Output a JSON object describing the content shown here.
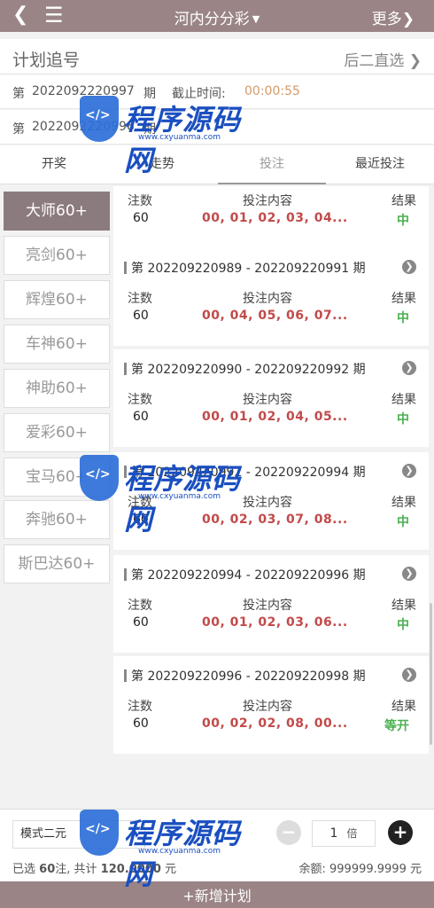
{
  "header": {
    "back_icon": "back-arrow-icon",
    "menu_icon": "hamburger-menu-icon",
    "title": "河内分分彩",
    "more_label": "更多"
  },
  "subhead": {
    "left_label": "计划追号",
    "right_label": "后二直选"
  },
  "issue_rows": [
    {
      "prefix": "第",
      "number": "2022092220997",
      "suffix": "期",
      "deadline_label": "截止时间:",
      "deadline_value": "00:00:55"
    },
    {
      "prefix": "第",
      "number": "2022092220996",
      "suffix": "期"
    }
  ],
  "tabs": [
    "开奖",
    "走势",
    "投注",
    "最近投注"
  ],
  "sidebar": [
    "大师60+",
    "亮剑60+",
    "辉煌60+",
    "车神60+",
    "神助60+",
    "爱彩60+",
    "宝马60+",
    "奔驰60+",
    "斯巴达60+"
  ],
  "card_labels": {
    "count": "注数",
    "content": "投注内容",
    "result": "结果"
  },
  "cards": [
    {
      "period": "",
      "count": "60",
      "numbers": "00, 01, 02, 03, 04...",
      "result": "中"
    },
    {
      "period": "第 202209220989 - 202209220991 期",
      "count": "60",
      "numbers": "00, 04, 05, 06, 07...",
      "result": "中"
    },
    {
      "period": "第 202209220990 - 202209220992 期",
      "count": "60",
      "numbers": "00, 01, 02, 04, 05...",
      "result": "中"
    },
    {
      "period": "第 202209220992 - 202209220994 期",
      "count": "60",
      "numbers": "00, 02, 03, 07, 08...",
      "result": "中"
    },
    {
      "period": "第 202209220994 - 202209220996 期",
      "count": "60",
      "numbers": "00, 01, 02, 03, 06...",
      "result": "中"
    },
    {
      "period": "第 202209220996 - 202209220998 期",
      "count": "60",
      "numbers": "00, 02, 02, 08, 00...",
      "result": "等开"
    }
  ],
  "bottom": {
    "mode": "模式二元",
    "quantity": "1",
    "unit": "倍",
    "summary_prefix": "已选",
    "selected_count": "60",
    "summary_mid": "注, 共计",
    "total": "120.0000",
    "summary_suffix": "元",
    "balance_label": "余额:",
    "balance_value": "999999.9999",
    "balance_unit": "元"
  },
  "add_plan_label": "+新增计划",
  "watermark": {
    "text": "程序源码网",
    "url": "www.cxyuanma.com"
  },
  "colors": {
    "header_bg": "#9a8486",
    "active_sidebar": "#8c7b7e",
    "numbers": "#c24a4a",
    "win": "#4caf50",
    "deadline": "#d49a6a"
  }
}
